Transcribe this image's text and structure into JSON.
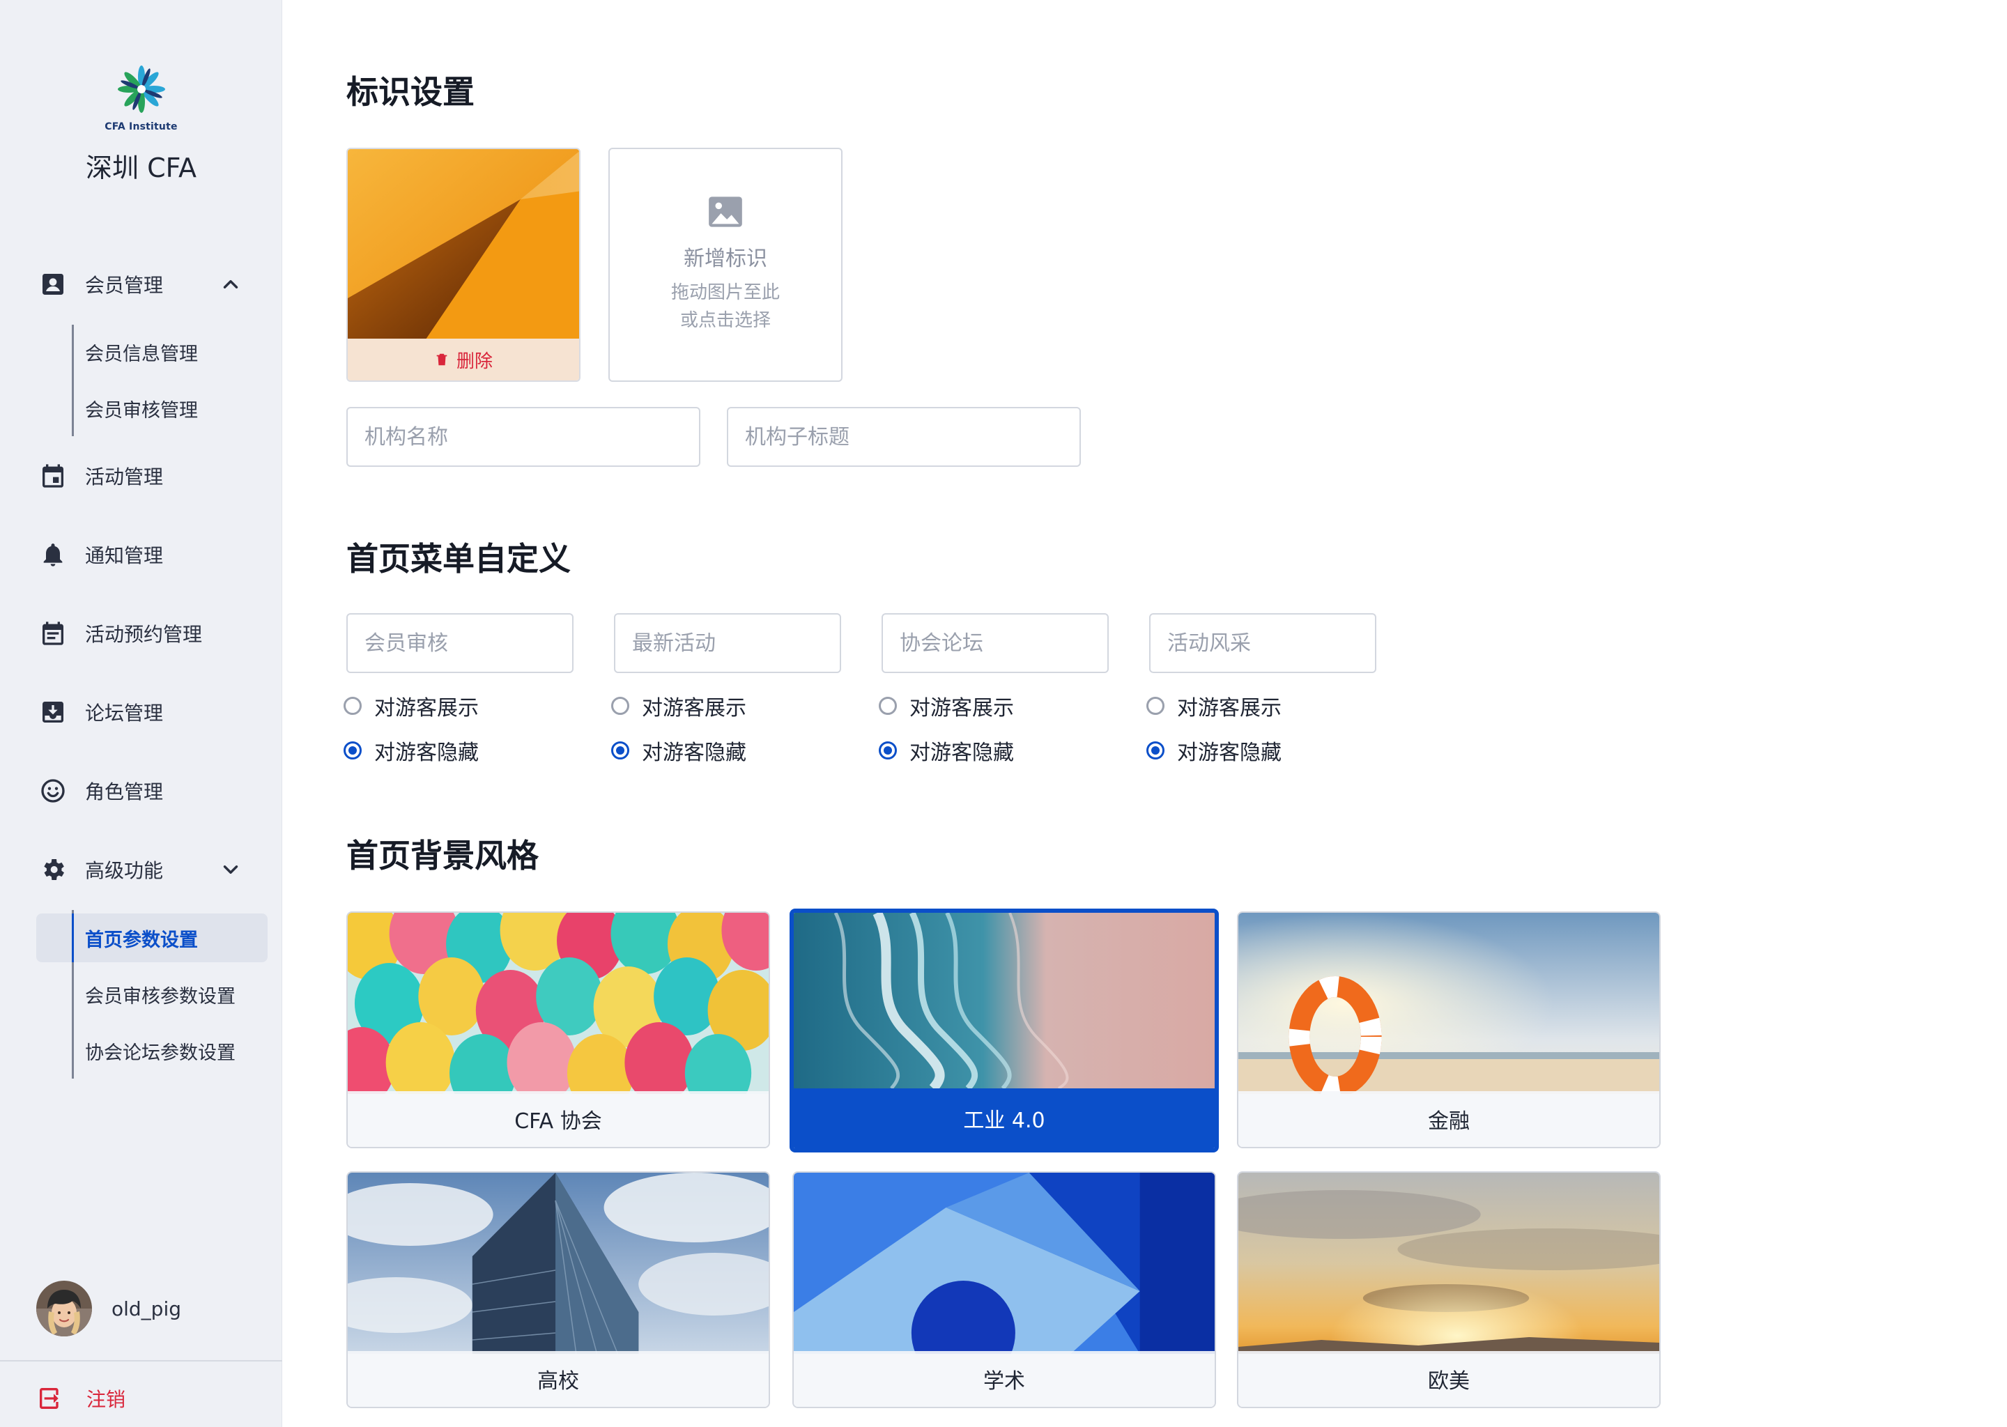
{
  "brand": {
    "logo_text": "CFA Institute",
    "name": "深圳 CFA"
  },
  "sidebar": {
    "member": {
      "label": "会员管理",
      "children": [
        "会员信息管理",
        "会员审核管理"
      ]
    },
    "items": [
      {
        "label": "活动管理",
        "icon": "calendar-icon"
      },
      {
        "label": "通知管理",
        "icon": "bell-icon"
      },
      {
        "label": "活动预约管理",
        "icon": "calendar-list-icon"
      },
      {
        "label": "论坛管理",
        "icon": "inbox-download-icon"
      },
      {
        "label": "角色管理",
        "icon": "smiley-icon"
      }
    ],
    "advanced": {
      "label": "高级功能",
      "children": [
        "首页参数设置",
        "会员审核参数设置",
        "协会论坛参数设置"
      ],
      "active_child": "首页参数设置"
    }
  },
  "user": {
    "name": "old_pig"
  },
  "logout": {
    "label": "注销"
  },
  "colors": {
    "accent": "#0b4fc9",
    "danger": "#d9263b",
    "sidebar_bg": "#eef0f5"
  },
  "logo_section": {
    "title": "标识设置",
    "delete_label": "删除",
    "upload": {
      "title": "新增标识",
      "hint1": "拖动图片至此",
      "hint2": "或点击选择"
    },
    "org_name_placeholder": "机构名称",
    "org_subtitle_placeholder": "机构子标题"
  },
  "menu_section": {
    "title": "首页菜单自定义",
    "menus": [
      {
        "placeholder": "会员审核",
        "show_label": "对游客展示",
        "hide_label": "对游客隐藏",
        "selected": "hide"
      },
      {
        "placeholder": "最新活动",
        "show_label": "对游客展示",
        "hide_label": "对游客隐藏",
        "selected": "hide"
      },
      {
        "placeholder": "协会论坛",
        "show_label": "对游客展示",
        "hide_label": "对游客隐藏",
        "selected": "hide"
      },
      {
        "placeholder": "活动风采",
        "show_label": "对游客展示",
        "hide_label": "对游客隐藏",
        "selected": "hide"
      }
    ]
  },
  "bg_section": {
    "title": "首页背景风格",
    "styles": [
      {
        "label": "CFA 协会",
        "image": "colorful balloons"
      },
      {
        "label": "工业 4.0",
        "image": "aerial ocean waves",
        "selected": true
      },
      {
        "label": "金融",
        "image": "life buoy on beach"
      },
      {
        "label": "高校",
        "image": "glass skyscraper and clouds"
      },
      {
        "label": "学术",
        "image": "blue geometric shapes"
      },
      {
        "label": "欧美",
        "image": "sunset clouds"
      }
    ]
  }
}
